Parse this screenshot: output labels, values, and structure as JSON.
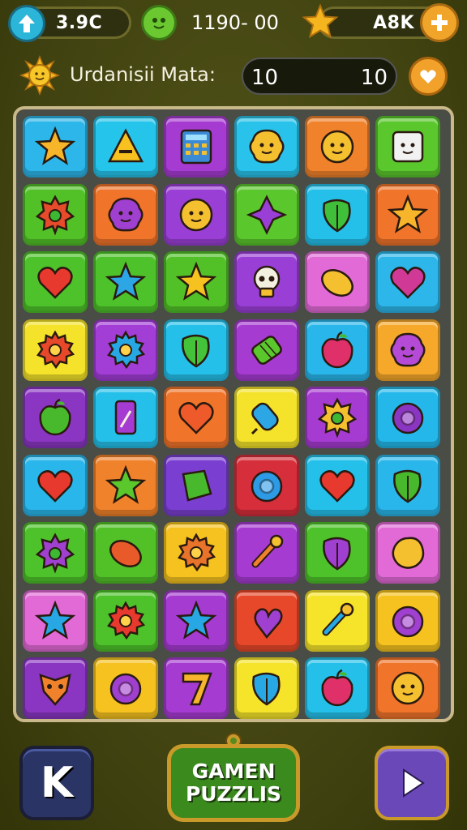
{
  "hud": {
    "lives_value": "3.9C",
    "score_value": "1190- 00",
    "coins_value": "A8K",
    "lives_icon": "arrow-up-icon",
    "score_icon": "green-face-icon",
    "coins_icon": "star-icon",
    "add_icon": "plus-icon"
  },
  "level": {
    "title": "Urdanisii Mata:",
    "value_left": "10",
    "value_right": "10",
    "sun_icon": "sun-icon",
    "action_icon": "heart-arrow-icon"
  },
  "board": {
    "columns": 6,
    "rows": 9,
    "tiles": [
      [
        "#2db6ea",
        "star",
        "#f7b52a"
      ],
      [
        "#25c4ea",
        "triangle",
        "#f7c21f"
      ],
      [
        "#a63bd1",
        "calculator",
        "#3b8ad6"
      ],
      [
        "#28c2ea",
        "blob-face",
        "#f4c030"
      ],
      [
        "#f0822b",
        "face",
        "#f4c030"
      ],
      [
        "#5ac72c",
        "box-face",
        "#f2f2f2"
      ],
      [
        "#52c128",
        "badge",
        "#e64b2b"
      ],
      [
        "#f0742a",
        "blob-face",
        "#a040d0"
      ],
      [
        "#9a3fd6",
        "face",
        "#f4c030"
      ],
      [
        "#5ac72c",
        "diamond-star",
        "#9a3fd6"
      ],
      [
        "#24c0ea",
        "leaf",
        "#3fbf3a"
      ],
      [
        "#f0742a",
        "star",
        "#f6b52b"
      ],
      [
        "#4ec22a",
        "heart",
        "#e8392e"
      ],
      [
        "#4ec22a",
        "star",
        "#2da6e6"
      ],
      [
        "#52c128",
        "star",
        "#f6c21f"
      ],
      [
        "#9a3fd6",
        "skull",
        "#f4f0e0"
      ],
      [
        "#e26ad6",
        "bean",
        "#f4c030"
      ],
      [
        "#2db6ea",
        "heart",
        "#d03a96"
      ],
      [
        "#f4e32a",
        "gear",
        "#e8482a"
      ],
      [
        "#a23dd6",
        "gear",
        "#27a8e4"
      ],
      [
        "#24c0ea",
        "leaf",
        "#44c23a"
      ],
      [
        "#a63bd1",
        "roll",
        "#5ac72c"
      ],
      [
        "#29b6ea",
        "apple",
        "#e0306a"
      ],
      [
        "#f6a82a",
        "blob-face",
        "#b44ad6"
      ],
      [
        "#8a36c2",
        "apple",
        "#48b82c"
      ],
      [
        "#24c0ea",
        "jar",
        "#a63bd1"
      ],
      [
        "#f0742a",
        "heart",
        "#ee5a2a"
      ],
      [
        "#f4e32a",
        "popsicle",
        "#2da6e6"
      ],
      [
        "#a63bd1",
        "badge",
        "#f4c030"
      ],
      [
        "#24b8ea",
        "ring",
        "#8a36c2"
      ],
      [
        "#29b6ea",
        "heart",
        "#e8392e"
      ],
      [
        "#f0822b",
        "star",
        "#5ac72c"
      ],
      [
        "#7a3fd0",
        "square",
        "#48b82c"
      ],
      [
        "#d62e3a",
        "ring",
        "#2d9ae6"
      ],
      [
        "#24c0ea",
        "heart",
        "#e8392e"
      ],
      [
        "#29b6ea",
        "leaf",
        "#48b82c"
      ],
      [
        "#4ec22a",
        "badge",
        "#a040d0"
      ],
      [
        "#52c128",
        "bean",
        "#e85a2a"
      ],
      [
        "#f6c21f",
        "gear",
        "#e8732a"
      ],
      [
        "#a63bd1",
        "wand",
        "#f0822b"
      ],
      [
        "#4ec22a",
        "leaf",
        "#a040d0"
      ],
      [
        "#e26ad6",
        "blob",
        "#f4c030"
      ],
      [
        "#e26ad6",
        "star",
        "#27a8e4"
      ],
      [
        "#4ec22a",
        "gear",
        "#e8392e"
      ],
      [
        "#a63bd1",
        "star",
        "#27a8e4"
      ],
      [
        "#e8482a",
        "heart-shape",
        "#a040d0"
      ],
      [
        "#f6e42a",
        "wand",
        "#27a8e4"
      ],
      [
        "#f6c21f",
        "ring",
        "#a040d0"
      ],
      [
        "#8a36c2",
        "mask",
        "#f0822b"
      ],
      [
        "#f6c21f",
        "ring",
        "#a040d0"
      ],
      [
        "#a63bd1",
        "seven",
        "#f6b52b"
      ],
      [
        "#f6e42a",
        "leaf",
        "#27a8e4"
      ],
      [
        "#24c0ea",
        "apple",
        "#e0306a"
      ],
      [
        "#f0742a",
        "face",
        "#f4c030"
      ]
    ]
  },
  "bottom": {
    "back_label": "K",
    "game_line1": "GAMEN",
    "game_line2": "PUZZLIS",
    "play_icon": "play-icon"
  },
  "colors": {
    "background": "#4a4a14",
    "board_border": "#c9b88a",
    "game_button": "#3a8a1e"
  }
}
